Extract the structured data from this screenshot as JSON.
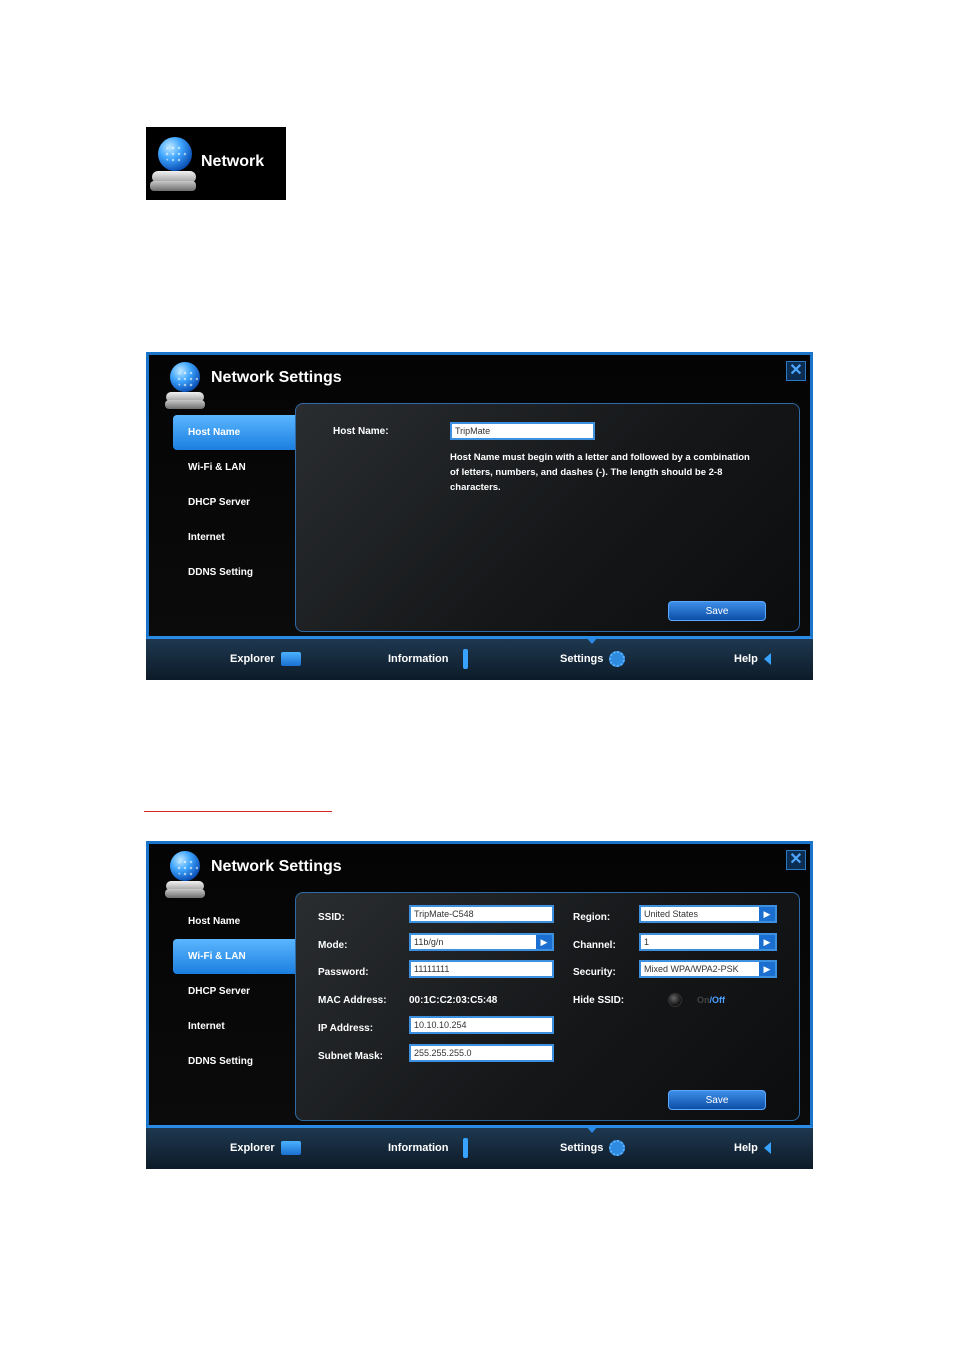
{
  "badge": {
    "label": "Network"
  },
  "dialog1": {
    "title": "Network Settings",
    "close": "✕",
    "sidebar": [
      "Host Name",
      "Wi-Fi & LAN",
      "DHCP Server",
      "Internet",
      "DDNS Setting"
    ],
    "active_index": 0,
    "host_name_label": "Host Name:",
    "host_name_value": "TripMate",
    "note_line1": "Host Name must begin with a letter and followed by a combination",
    "note_line2": "of letters, numbers, and dashes (-). The length should be 2-8",
    "note_line3": "characters.",
    "save_label": "Save",
    "nav": [
      "Explorer",
      "Information",
      "Settings",
      "Help"
    ]
  },
  "dialog2": {
    "title": "Network Settings",
    "close": "✕",
    "sidebar": [
      "Host Name",
      "Wi-Fi & LAN",
      "DHCP Server",
      "Internet",
      "DDNS Setting"
    ],
    "active_index": 1,
    "fields": {
      "ssid_label": "SSID:",
      "ssid_value": "TripMate-C548",
      "mode_label": "Mode:",
      "mode_value": "11b/g/n",
      "password_label": "Password:",
      "password_value": "11111111",
      "mac_label": "MAC Address:",
      "mac_value": "00:1C:C2:03:C5:48",
      "ip_label": "IP Address:",
      "ip_value": "10.10.10.254",
      "subnet_label": "Subnet Mask:",
      "subnet_value": "255.255.255.0",
      "region_label": "Region:",
      "region_value": "United States",
      "channel_label": "Channel:",
      "channel_value": "1",
      "security_label": "Security:",
      "security_value": "Mixed WPA/WPA2-PSK",
      "hide_ssid_label": "Hide SSID:",
      "on": "On",
      "sep": "/",
      "off": "Off"
    },
    "save_label": "Save",
    "nav": [
      "Explorer",
      "Information",
      "Settings",
      "Help"
    ]
  },
  "icons": {
    "globe": "network-globe-icon",
    "close": "close-icon",
    "explorer": "folder-icon",
    "information": "exclamation-icon",
    "settings": "gear-icon",
    "help": "arrow-left-icon",
    "dropdown": "chevron-right-icon"
  },
  "colors": {
    "accent": "#1a74c9",
    "active_tab": "#3a9cf5",
    "link_red": "#dd2222"
  }
}
